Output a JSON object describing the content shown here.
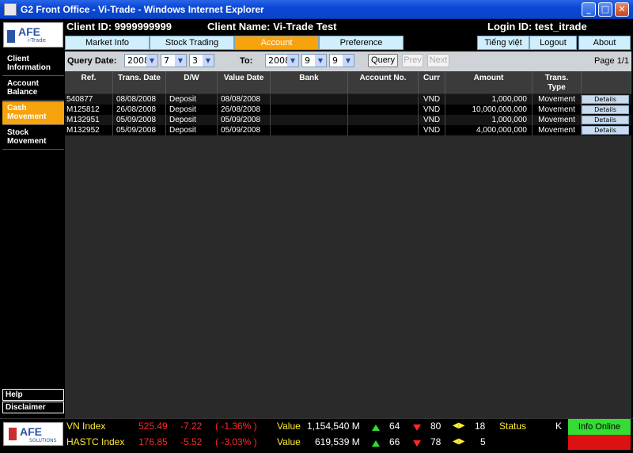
{
  "window": {
    "title": "G2 Front Office - Vi-Trade - Windows Internet Explorer"
  },
  "header": {
    "logo_text": "AFE",
    "logo_sub": "i-Trade",
    "client_id": "Client ID: 9999999999",
    "client_name": "Client Name: Vi-Trade Test",
    "login_id": "Login ID: test_itrade"
  },
  "topnav": {
    "market_info": "Market Info",
    "stock_trading": "Stock Trading",
    "account": "Account",
    "preference": "Preference",
    "language": "Tiếng việt",
    "logout": "Logout",
    "about": "About"
  },
  "sidebar": {
    "items": [
      {
        "label_1": "Client",
        "label_2": "Information"
      },
      {
        "label_1": "Account",
        "label_2": "Balance"
      },
      {
        "label_1": "Cash",
        "label_2": "Movement"
      },
      {
        "label_1": "Stock",
        "label_2": "Movement"
      }
    ],
    "help": "Help",
    "disclaimer": "Disclaimer"
  },
  "query": {
    "from_label": "Query Date:",
    "to_label": "To:",
    "from_year": "2008",
    "from_month": "7",
    "from_day": "3",
    "to_year": "2008",
    "to_month": "9",
    "to_day": "9",
    "query_btn": "Query",
    "prev_btn": "Prev",
    "next_btn": "Next",
    "page": "Page 1/1"
  },
  "table": {
    "headers": {
      "ref": "Ref.",
      "trans_date": "Trans. Date",
      "dw": "D/W",
      "value_date": "Value Date",
      "bank": "Bank",
      "account_no": "Account No.",
      "curr": "Curr",
      "amount": "Amount",
      "trans_type_1": "Trans.",
      "trans_type_2": "Type"
    },
    "rows": [
      {
        "ref": "540877",
        "trans_date": "08/08/2008",
        "dw": "Deposit",
        "value_date": "08/08/2008",
        "bank": "",
        "account_no": "",
        "curr": "VND",
        "amount": "1,000,000",
        "type": "Movement",
        "details": "Details"
      },
      {
        "ref": "M125812",
        "trans_date": "26/08/2008",
        "dw": "Deposit",
        "value_date": "26/08/2008",
        "bank": "",
        "account_no": "",
        "curr": "VND",
        "amount": "10,000,000,000",
        "type": "Movement",
        "details": "Details"
      },
      {
        "ref": "M132951",
        "trans_date": "05/09/2008",
        "dw": "Deposit",
        "value_date": "05/09/2008",
        "bank": "",
        "account_no": "",
        "curr": "VND",
        "amount": "1,000,000",
        "type": "Movement",
        "details": "Details"
      },
      {
        "ref": "M132952",
        "trans_date": "05/09/2008",
        "dw": "Deposit",
        "value_date": "05/09/2008",
        "bank": "",
        "account_no": "",
        "curr": "VND",
        "amount": "4,000,000,000",
        "type": "Movement",
        "details": "Details"
      }
    ]
  },
  "footer": {
    "logo_text": "AFE",
    "logo_sub": "SOLUTIONS",
    "vn": {
      "name": "VN Index",
      "value": "525.49",
      "change": "-7.22",
      "pct": "( -1.36% )",
      "value_label": "Value",
      "volume": "1,154,540 M",
      "up": "64",
      "down": "80",
      "flat": "18",
      "status_label": "Status",
      "status_val": "K"
    },
    "hastc": {
      "name": "HASTC Index",
      "value": "176.85",
      "change": "-5.52",
      "pct": "( -3.03% )",
      "value_label": "Value",
      "volume": "619,539 M",
      "up": "66",
      "down": "78",
      "flat": "5"
    },
    "online": "Info Online"
  },
  "colors": {
    "accent": "#f7a30d",
    "nav_bg": "#cfeefe",
    "online": "#33dd33",
    "offline": "#dd1111"
  }
}
